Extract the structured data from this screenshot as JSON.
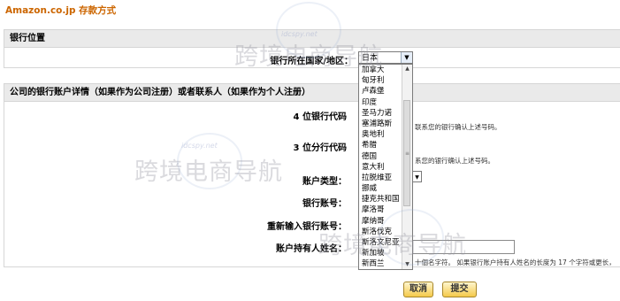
{
  "page_title": "Amazon.co.jp 存款方式",
  "bank_location": {
    "header": "银行位置",
    "country_label": "银行所在国家/地区：",
    "country_value": "日本"
  },
  "bank_details": {
    "header": "公司的银行账户详情（如果作为公司注册）或者联系人（如果作为个人注册）",
    "bank_code_label": "4 位银行代码",
    "bank_code_hint": "联系您的银行确认上述号码。",
    "branch_code_label": "3 位分行代码",
    "branch_code_hint": "系您的银行确认上述号码。",
    "account_type_label": "账户类型：",
    "account_number_label": "银行账号：",
    "account_number_confirm_label": "重新输入银行账号：",
    "holder_name_label": "账户持有人姓名：",
    "holder_name_hint": "十個名字符。 如果银行账户持有人姓名的长度为 17 个字符或更长，"
  },
  "dropdown": {
    "options": [
      "加拿大",
      "匈牙利",
      "卢森堡",
      "印度",
      "圣马力诺",
      "塞浦路斯",
      "奥地利",
      "希腊",
      "德国",
      "意大利",
      "拉脱维亚",
      "挪威",
      "捷克共和国",
      "摩洛哥",
      "摩纳哥",
      "斯洛伐克",
      "斯洛文尼亚",
      "新加坡",
      "新西兰",
      "日本"
    ],
    "selected": "日本"
  },
  "buttons": {
    "cancel": "取消",
    "submit": "提交"
  },
  "watermark": {
    "text": "跨境电商导航",
    "site": "idcspy.net"
  },
  "colors": {
    "title": "#cc6600",
    "section_header_bg": "#eaeaea",
    "selected_option_bg": "#3399ff",
    "button_gradient_top": "#fff6cf",
    "button_gradient_bottom": "#f4c94a"
  },
  "icons": {
    "dropdown_arrow": "chevron-down-icon",
    "scroll_up": "arrow-up-icon",
    "scroll_down": "arrow-down-icon"
  }
}
